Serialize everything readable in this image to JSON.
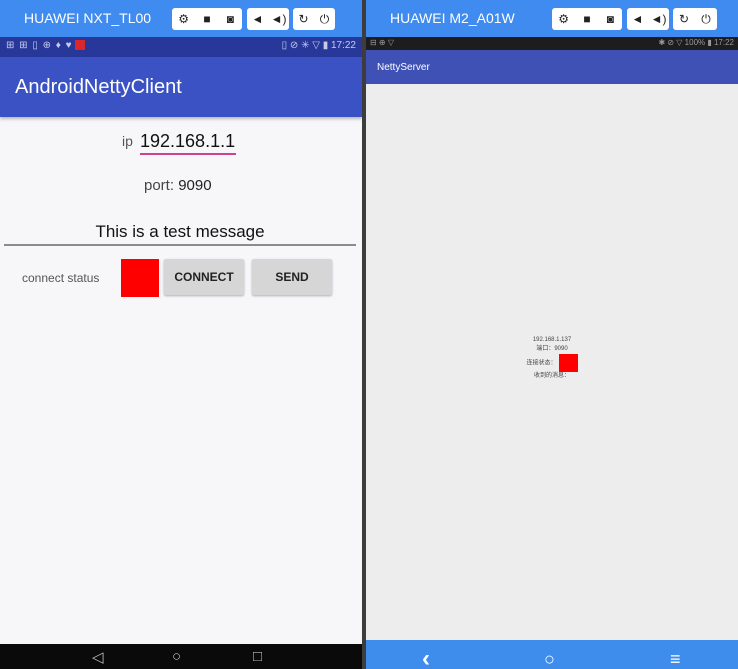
{
  "left_device": {
    "title": "HUAWEI NXT_TL00",
    "controls": {
      "settings": "⚙",
      "video": "■",
      "camera": "◙",
      "vol_down": "◄",
      "vol_up": "◄)",
      "rotate": "↻",
      "power": "⏻"
    },
    "status_bar": {
      "left": "⊞ ⊞ ▯ ⊕ ♦ ♥",
      "right": "▯ ⊘ ✳ ▽ ▮ 17:22"
    },
    "app": {
      "title": "AndroidNettyClient",
      "ip_label": "ip",
      "ip_value": "192.168.1.1",
      "port_label": "port:",
      "port_value": "9090",
      "message": "This is a test message",
      "connect_status_label": "connect status",
      "connect_status_color": "#ff0000",
      "connect_button": "CONNECT",
      "send_button": "SEND"
    },
    "nav": {
      "back": "◁",
      "home": "○",
      "recent": "□"
    }
  },
  "right_device": {
    "title": "HUAWEI M2_A01W",
    "controls": {
      "settings": "⚙",
      "video": "■",
      "camera": "◙",
      "vol_down": "◄",
      "vol_up": "◄)",
      "rotate": "↻",
      "power": "⏻"
    },
    "status_bar": {
      "left": "⊟ ⊕ ▽",
      "right": "✱ ⊘ ▽ 100% ▮ 17:22"
    },
    "app": {
      "title": "NettyServer",
      "ip": "192.168.1.137",
      "port": "端口：9090",
      "status_label": "连接状态：",
      "status_color": "#ff0000",
      "received_label": "收到的消息："
    },
    "nav": {
      "back": "‹",
      "home": "○",
      "menu": "≡"
    }
  }
}
